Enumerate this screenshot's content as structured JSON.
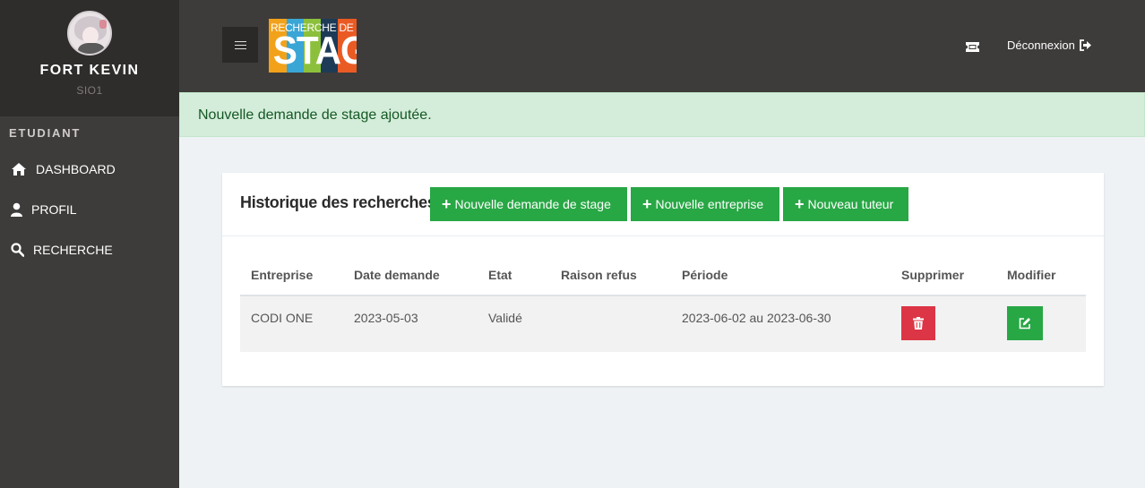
{
  "sidebar": {
    "name": "FORT KEVIN",
    "class": "SIO1",
    "section": "ETUDIANT",
    "items": [
      {
        "label": "DASHBOARD",
        "icon": "home-icon"
      },
      {
        "label": "PROFIL",
        "icon": "user-icon"
      },
      {
        "label": "RECHERCHE",
        "icon": "search-icon"
      }
    ]
  },
  "topbar": {
    "logo_top": "RECHERCHE DE",
    "logo_big": "STAGE",
    "logout_label": "Déconnexion"
  },
  "alert": {
    "message": "Nouvelle demande de stage ajoutée."
  },
  "card": {
    "title": "Historique des recherches",
    "buttons": [
      "Nouvelle demande de stage",
      "Nouvelle entreprise",
      "Nouveau tuteur"
    ]
  },
  "table": {
    "headers": [
      "Entreprise",
      "Date demande",
      "Etat",
      "Raison refus",
      "Période",
      "Supprimer",
      "Modifier"
    ],
    "rows": [
      {
        "entreprise": "CODI ONE",
        "date": "2023-05-03",
        "etat": "Validé",
        "raison": "",
        "periode": "2023-06-02 au 2023-06-30"
      }
    ]
  },
  "colors": {
    "sidebar_bg": "#3e3c3b",
    "success": "#28a745",
    "danger": "#dc3545",
    "alert_bg": "#d4edda",
    "alert_text": "#155724"
  }
}
